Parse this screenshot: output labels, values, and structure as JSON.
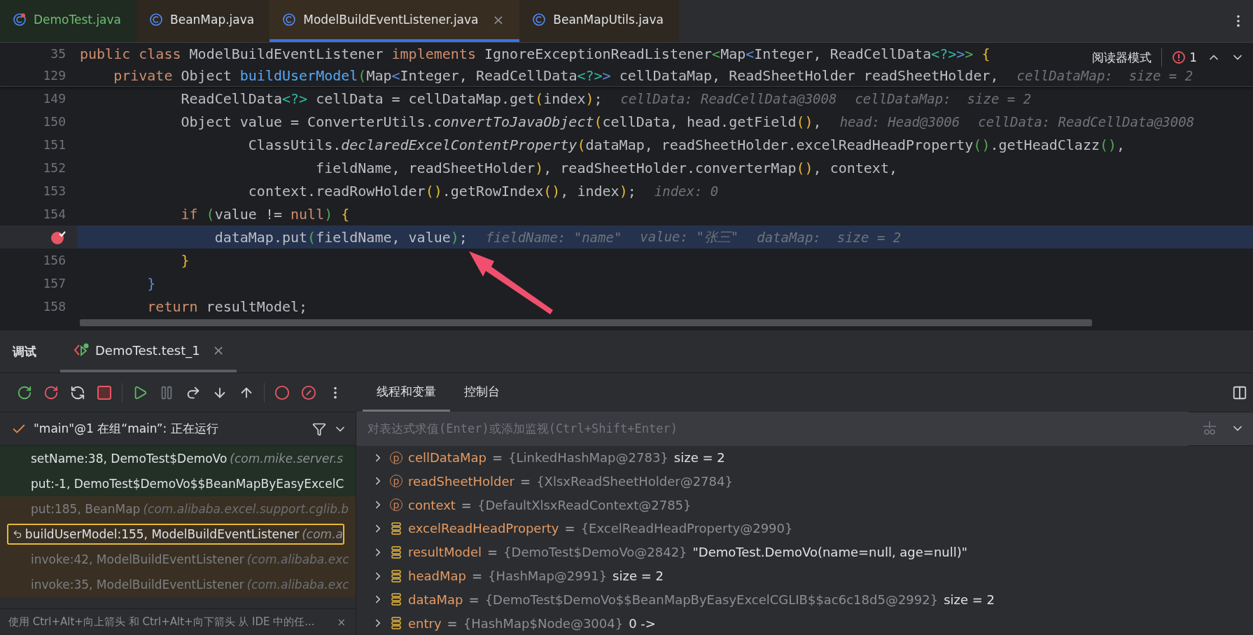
{
  "editor_tabs": [
    {
      "label": "DemoTest.java",
      "kind": "test",
      "color": "#1f2a21",
      "selected": false
    },
    {
      "label": "BeanMap.java",
      "kind": "class",
      "color": "#2e2820",
      "selected": false
    },
    {
      "label": "ModelBuildEventListener.java",
      "kind": "class",
      "color": "#372d21",
      "selected": true,
      "close": "×"
    },
    {
      "label": "BeanMapUtils.java",
      "kind": "class",
      "color": "#2e2820",
      "selected": false
    }
  ],
  "editor": {
    "reader_mode": "阅读器模式",
    "problems_count": "1",
    "sticky_lines": [
      {
        "number": "35",
        "tokens": [
          {
            "kind": "kw",
            "text": "public class "
          },
          {
            "kind": "id",
            "text": "ModelBuildEventListener "
          },
          {
            "kind": "kw",
            "text": "implements "
          },
          {
            "kind": "id",
            "text": "IgnoreExceptionReadListener"
          },
          {
            "kind": "b2",
            "text": "<"
          },
          {
            "kind": "id",
            "text": "Map"
          },
          {
            "kind": "b3",
            "text": "<"
          },
          {
            "kind": "id",
            "text": "Integer, ReadCellData"
          },
          {
            "kind": "b4",
            "text": "<?>"
          },
          {
            "kind": "b3",
            "text": ">"
          },
          {
            "kind": "b2",
            "text": ">"
          },
          {
            "kind": "b1",
            "text": " {"
          }
        ]
      },
      {
        "number": "129",
        "tokens": [
          {
            "kind": "kw",
            "text": "    private "
          },
          {
            "kind": "id",
            "text": "Object "
          },
          {
            "kind": "fn",
            "text": "buildUserModel"
          },
          {
            "kind": "b2",
            "text": "("
          },
          {
            "kind": "id",
            "text": "Map"
          },
          {
            "kind": "b3",
            "text": "<"
          },
          {
            "kind": "id",
            "text": "Integer, ReadCellData"
          },
          {
            "kind": "b4",
            "text": "<?>"
          },
          {
            "kind": "b3",
            "text": ">"
          },
          {
            "kind": "id",
            "text": " cellDataMap, ReadSheetHolder readSheetHolder,"
          }
        ],
        "hints": [
          "cellDataMap:  size = 2"
        ]
      }
    ],
    "lines": [
      {
        "number": "149",
        "current": false,
        "breakpoint": false,
        "tokens": [
          {
            "kind": "id",
            "text": "            ReadCellData"
          },
          {
            "kind": "b4",
            "text": "<?>"
          },
          {
            "kind": "id",
            "text": " cellData = cellDataMap.get"
          },
          {
            "kind": "b1",
            "text": "("
          },
          {
            "kind": "id",
            "text": "index"
          },
          {
            "kind": "b1",
            "text": ")"
          },
          {
            "kind": "id",
            "text": ";"
          }
        ],
        "hints": [
          "cellData: ReadCellData@3008",
          "cellDataMap:  size = 2"
        ]
      },
      {
        "number": "150",
        "current": false,
        "breakpoint": false,
        "tokens": [
          {
            "kind": "id",
            "text": "            Object value = ConverterUtils."
          },
          {
            "kind": "st",
            "text": "convertToJavaObject"
          },
          {
            "kind": "b1",
            "text": "("
          },
          {
            "kind": "id",
            "text": "cellData, head.getField"
          },
          {
            "kind": "b1",
            "text": "()"
          },
          {
            "kind": "id",
            "text": ","
          }
        ],
        "hints": [
          "head: Head@3006",
          "cellData: ReadCellData@3008"
        ]
      },
      {
        "number": "151",
        "current": false,
        "breakpoint": false,
        "tokens": [
          {
            "kind": "id",
            "text": "                    ClassUtils."
          },
          {
            "kind": "st",
            "text": "declaredExcelContentProperty"
          },
          {
            "kind": "b1",
            "text": "("
          },
          {
            "kind": "id",
            "text": "dataMap, readSheetHolder.excelReadHeadProperty"
          },
          {
            "kind": "b2",
            "text": "()"
          },
          {
            "kind": "id",
            "text": ".getHeadClazz"
          },
          {
            "kind": "b2",
            "text": "()"
          },
          {
            "kind": "id",
            "text": ","
          }
        ]
      },
      {
        "number": "152",
        "current": false,
        "breakpoint": false,
        "tokens": [
          {
            "kind": "id",
            "text": "                            fieldName, readSheetHolder"
          },
          {
            "kind": "b1",
            "text": ")"
          },
          {
            "kind": "id",
            "text": ", readSheetHolder.converterMap"
          },
          {
            "kind": "b1",
            "text": "()"
          },
          {
            "kind": "id",
            "text": ", context,"
          }
        ]
      },
      {
        "number": "153",
        "current": false,
        "breakpoint": false,
        "tokens": [
          {
            "kind": "id",
            "text": "                    context.readRowHolder"
          },
          {
            "kind": "b1",
            "text": "()"
          },
          {
            "kind": "id",
            "text": ".getRowIndex"
          },
          {
            "kind": "b1",
            "text": "()"
          },
          {
            "kind": "id",
            "text": ", index"
          },
          {
            "kind": "b1",
            "text": ")"
          },
          {
            "kind": "id",
            "text": ";"
          }
        ],
        "hints": [
          "index: 0"
        ]
      },
      {
        "number": "154",
        "current": false,
        "breakpoint": false,
        "tokens": [
          {
            "kind": "kw",
            "text": "            if "
          },
          {
            "kind": "b2",
            "text": "("
          },
          {
            "kind": "id",
            "text": "value != "
          },
          {
            "kind": "kw",
            "text": "null"
          },
          {
            "kind": "b2",
            "text": ")"
          },
          {
            "kind": "b1",
            "text": " {"
          }
        ]
      },
      {
        "current": true,
        "breakpoint": true,
        "tokens": [
          {
            "kind": "id",
            "text": "                dataMap.put"
          },
          {
            "kind": "b2",
            "text": "("
          },
          {
            "kind": "id",
            "text": "fieldName, value"
          },
          {
            "kind": "b2",
            "text": ")"
          },
          {
            "kind": "id",
            "text": ";"
          }
        ],
        "hints": [
          "fieldName: \"name\"",
          "value: \"张三\"",
          "dataMap:  size = 2"
        ]
      },
      {
        "number": "156",
        "current": false,
        "breakpoint": false,
        "tokens": [
          {
            "kind": "b1",
            "text": "            }"
          }
        ]
      },
      {
        "number": "157",
        "current": false,
        "breakpoint": false,
        "tokens": [
          {
            "kind": "b3",
            "text": "        }"
          }
        ]
      },
      {
        "number": "158",
        "current": false,
        "breakpoint": false,
        "tokens": [
          {
            "kind": "kw",
            "text": "        return "
          },
          {
            "kind": "id",
            "text": "resultModel;"
          }
        ]
      }
    ]
  },
  "debug": {
    "title": "调试",
    "session_tab": {
      "label": "DemoTest.test_1",
      "close": "×"
    },
    "view_tabs": [
      {
        "label": "线程和变量",
        "selected": true
      },
      {
        "label": "控制台",
        "selected": false
      }
    ],
    "thread": "\"main\"@1 在组“main”: 正在运行",
    "frames": [
      {
        "method": "setName:38, DemoTest$DemoVo",
        "package": "(com.mike.server.s",
        "color": "#223025",
        "dimmed": false,
        "selected": false
      },
      {
        "method": "put:-1, DemoTest$DemoVo$$BeanMapByEasyExcelC",
        "color": "#223025",
        "dimmed": false,
        "selected": false
      },
      {
        "method": "put:185, BeanMap",
        "package": "(com.alibaba.excel.support.cglib.b",
        "color": "#393023",
        "dimmed": true,
        "selected": false
      },
      {
        "method": "buildUserModel:155, ModelBuildEventListener",
        "package": "(com.a",
        "color": "#393023",
        "dimmed": false,
        "selected": true
      },
      {
        "method": "invoke:42, ModelBuildEventListener",
        "package": "(com.alibaba.exc",
        "color": "#393023",
        "dimmed": true,
        "selected": false
      },
      {
        "method": "invoke:35, ModelBuildEventListener",
        "package": "(com.alibaba.exc",
        "color": "#393023",
        "dimmed": true,
        "selected": false
      }
    ],
    "hint": "使用 Ctrl+Alt+向上箭头 和 Ctrl+Alt+向下箭头 从 IDE 中的任...",
    "hint_close": "×",
    "eval_placeholder": "对表达式求值(Enter)或添加监视(Ctrl+Shift+Enter)",
    "variables": [
      {
        "kind": "param",
        "badge": "p",
        "name": "cellDataMap",
        "eq": "=",
        "ref": "{LinkedHashMap@2783}",
        "value": "size = 2"
      },
      {
        "kind": "param",
        "badge": "p",
        "name": "readSheetHolder",
        "eq": "=",
        "ref": "{XlsxReadSheetHolder@2784}"
      },
      {
        "kind": "param",
        "badge": "p",
        "name": "context",
        "eq": "=",
        "ref": "{DefaultXlsxReadContext@2785}"
      },
      {
        "kind": "local",
        "name": "excelReadHeadProperty",
        "eq": "=",
        "ref": "{ExcelReadHeadProperty@2990}"
      },
      {
        "kind": "local",
        "name": "resultModel",
        "eq": "=",
        "ref": "{DemoTest$DemoVo@2842}",
        "value": "\"DemoTest.DemoVo(name=null, age=null)\""
      },
      {
        "kind": "local",
        "name": "headMap",
        "eq": "=",
        "ref": "{HashMap@2991}",
        "value": "size = 2"
      },
      {
        "kind": "local",
        "name": "dataMap",
        "eq": "=",
        "ref": "{DemoTest$DemoVo$$BeanMapByEasyExcelCGLIB$$ac6c18d5@2992}",
        "value": "size = 2"
      },
      {
        "kind": "local",
        "name": "entry",
        "eq": "=",
        "ref": "{HashMap$Node@3004}",
        "value": "0 ->"
      }
    ]
  }
}
